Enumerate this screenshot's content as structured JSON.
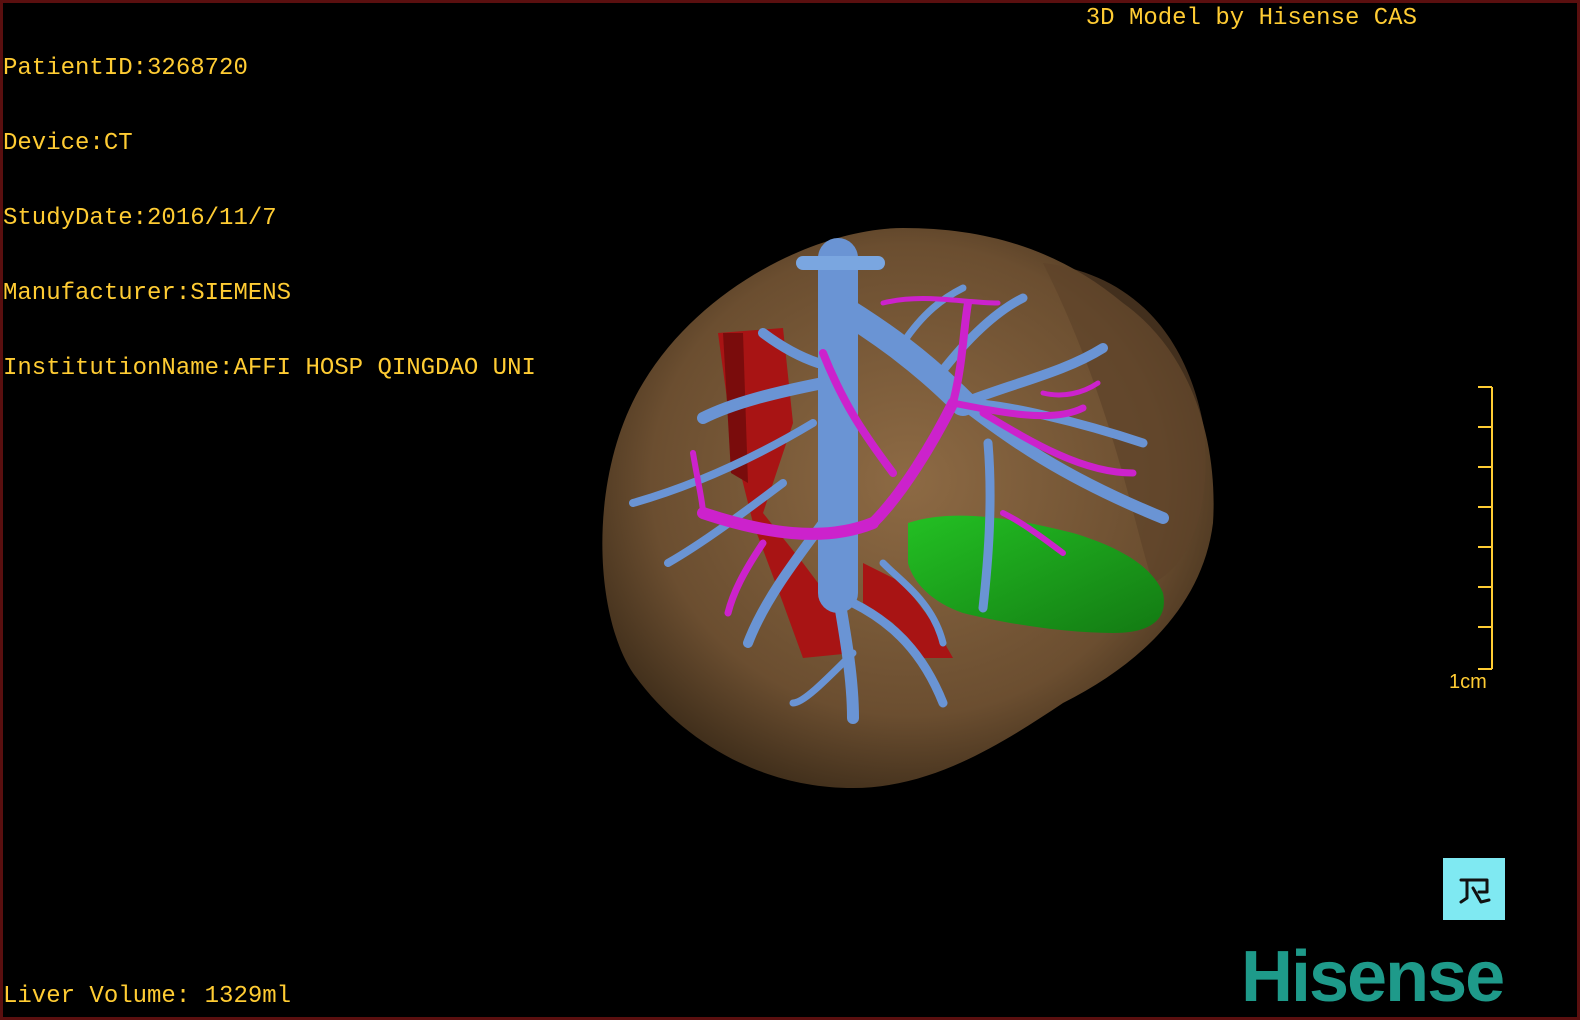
{
  "patient_info": {
    "patient_id": "PatientID:3268720",
    "device": "Device:CT",
    "study_date": "StudyDate:2016/11/7",
    "manufacturer": "Manufacturer:SIEMENS",
    "institution": "InstitutionName:AFFI HOSP QINGDAO UNI"
  },
  "model_credit": "3D Model by Hisense CAS",
  "liver_volume": "Liver Volume: 1329ml",
  "scale": {
    "label": "1cm",
    "ticks": 8
  },
  "orientation_button": {
    "icon": "orientation-icon"
  },
  "brand": {
    "logo_text": "Hisense",
    "color": "#1e9a8a"
  },
  "colors": {
    "overlay_text": "#ffcc33",
    "liver": "#7a5a36",
    "portal_vein": "#6a94d4",
    "hepatic_artery": "#cc22cc",
    "ivc": "#aa1515",
    "tumor": "#1fa31f",
    "background": "#000000"
  }
}
